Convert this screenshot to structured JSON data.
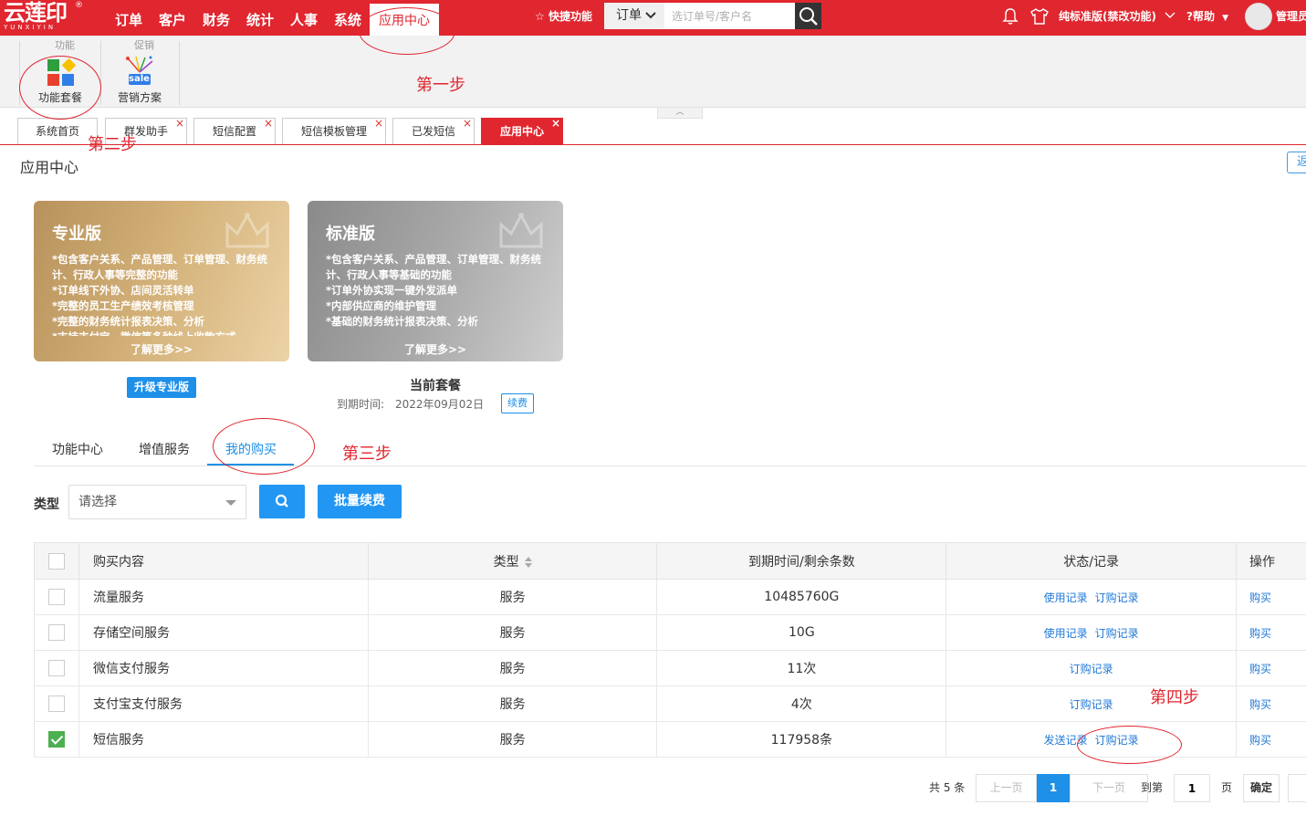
{
  "app": {
    "logo_cn": "云莲印",
    "logo_en": "YUNXIYIN",
    "logo_reg": "®"
  },
  "topnav": {
    "items": [
      "订单",
      "客户",
      "财务",
      "统计",
      "人事",
      "系统"
    ],
    "active": "应用中心",
    "quick_label": "快捷功能",
    "order_select": "订单",
    "search_placeholder": "选订单号/客户名",
    "edition": "纯标准版(禁改功能)",
    "help": "帮助",
    "admin": "管理员"
  },
  "ribbon": {
    "group1_label": "功能",
    "group2_label": "促销",
    "btn_package": "功能套餐",
    "btn_marketing": "营销方案",
    "sale_badge": "sale"
  },
  "tabs": [
    {
      "label": "系统首页",
      "closable": false
    },
    {
      "label": "群发助手",
      "closable": true
    },
    {
      "label": "短信配置",
      "closable": true
    },
    {
      "label": "短信模板管理",
      "closable": true
    },
    {
      "label": "已发短信",
      "closable": true
    },
    {
      "label": "应用中心",
      "closable": true,
      "active": true
    }
  ],
  "page": {
    "title": "应用中心",
    "back_label": "返"
  },
  "cards": {
    "pro": {
      "title": "专业版",
      "desc": "*包含客户关系、产品管理、订单管理、财务统计、行政人事等完整的功能\n*订单线下外协、店间灵活转单\n*完整的员工生产绩效考核管理\n*完整的财务统计报表决策、分析\n*支持支付宝、微信等多种线上收款方式",
      "more": "了解更多>>",
      "action": "升级专业版"
    },
    "std": {
      "title": "标准版",
      "desc": "*包含客户关系、产品管理、订单管理、财务统计、行政人事等基础的功能\n*订单外协实现一键外发派单\n*内部供应商的维护管理\n*基础的财务统计报表决策、分析",
      "more": "了解更多>>",
      "current": "当前套餐",
      "expire_label": "到期时间:",
      "expire_value": "2022年09月02日",
      "renew": "续费"
    }
  },
  "subtabs": [
    "功能中心",
    "增值服务",
    "我的购买"
  ],
  "filter": {
    "type_label": "类型",
    "type_placeholder": "请选择",
    "batch_renew": "批量续费"
  },
  "table": {
    "headers": [
      "购买内容",
      "类型",
      "到期时间/剩余条数",
      "状态/记录",
      "操作"
    ],
    "rows": [
      {
        "checked": false,
        "name": "流量服务",
        "type": "服务",
        "remain": "10485760G",
        "links": [
          "使用记录",
          "订购记录"
        ],
        "action": "购买"
      },
      {
        "checked": false,
        "name": "存储空间服务",
        "type": "服务",
        "remain": "10G",
        "links": [
          "使用记录",
          "订购记录"
        ],
        "action": "购买"
      },
      {
        "checked": false,
        "name": "微信支付服务",
        "type": "服务",
        "remain": "11次",
        "links": [
          "订购记录"
        ],
        "action": "购买"
      },
      {
        "checked": false,
        "name": "支付宝支付服务",
        "type": "服务",
        "remain": "4次",
        "links": [
          "订购记录"
        ],
        "action": "购买"
      },
      {
        "checked": true,
        "name": "短信服务",
        "type": "服务",
        "remain": "117958条",
        "links": [
          "发送记录",
          "订购记录"
        ],
        "action": "购买"
      }
    ]
  },
  "pagination": {
    "total": "共 5 条",
    "prev": "上一页",
    "current": "1",
    "next": "下一页",
    "goto": "到第",
    "goto_value": "1",
    "page_unit": "页",
    "confirm": "确定"
  },
  "annotations": {
    "step1": "第一步",
    "step2": "第二步",
    "step3": "第三步",
    "step4": "第四步"
  },
  "colors": {
    "brand_red": "#e0262f",
    "accent_blue": "#1e90e8",
    "check_green": "#4caf50"
  }
}
